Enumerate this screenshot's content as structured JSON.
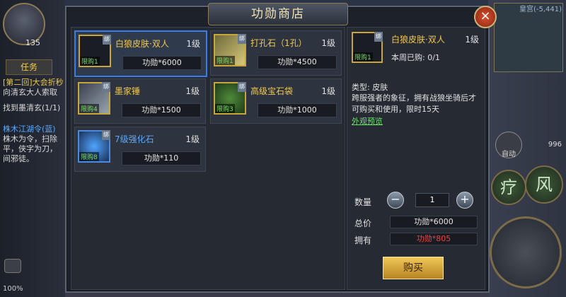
{
  "hud": {
    "player_level": "135",
    "quest_tab": "任务",
    "quest_lines": [
      "[第二回]大会折秒",
      "向清玄大人索取",
      "找到墨清玄(1/1)",
      "株木江湖令(蓝)",
      "株木为令，扫除",
      "平，侠字为刀，",
      "间邪徒。"
    ],
    "battery": "100%",
    "map_coord": "皇宫(-5,441)",
    "skill_chars": [
      "疗",
      "风"
    ],
    "auto_label": "自动",
    "potion_count": "996"
  },
  "panel": {
    "title": "功勋商店",
    "close_label": "×"
  },
  "items": [
    {
      "name": "白狼皮肤·双人",
      "level": "1级",
      "price": "功勋*6000",
      "limit": "限购1",
      "bind": "绑",
      "name_color": "gold",
      "selected": true
    },
    {
      "name": "打孔石（1孔）",
      "level": "1级",
      "price": "功勋*4500",
      "limit": "限购1",
      "bind": "绑",
      "name_color": "gold",
      "selected": false
    },
    {
      "name": "墨家锤",
      "level": "1级",
      "price": "功勋*1500",
      "limit": "限购4",
      "bind": "绑",
      "name_color": "gold",
      "selected": false
    },
    {
      "name": "高级宝石袋",
      "level": "1级",
      "price": "功勋*1000",
      "limit": "限购3",
      "bind": "绑",
      "name_color": "gold",
      "selected": false
    },
    {
      "name": "7级强化石",
      "level": "1级",
      "price": "功勋*110",
      "limit": "限购8",
      "bind": "绑",
      "name_color": "blue",
      "selected": false
    }
  ],
  "detail": {
    "name": "白狼皮肤·双人",
    "level": "1级",
    "limit": "限购1",
    "bind": "绑",
    "bought": "本周已购: 0/1",
    "type": "类型: 皮肤",
    "desc": "跨服强者的象征，拥有战狼坐骑后才可购买和使用，限时15天",
    "preview": "外观预览",
    "qty_label": "数量",
    "qty_minus": "−",
    "qty_plus": "+",
    "qty_value": "1",
    "total_label": "总价",
    "total_value": "功勋*6000",
    "own_label": "拥有",
    "own_value": "功勋*805",
    "buy_label": "购买"
  },
  "colors": {
    "gold_text": "#f2c94c",
    "blue_text": "#5aa9ff",
    "red_text": "#ff3b3b",
    "green_text": "#6ae06a",
    "selected_border": "#3a7de8"
  }
}
